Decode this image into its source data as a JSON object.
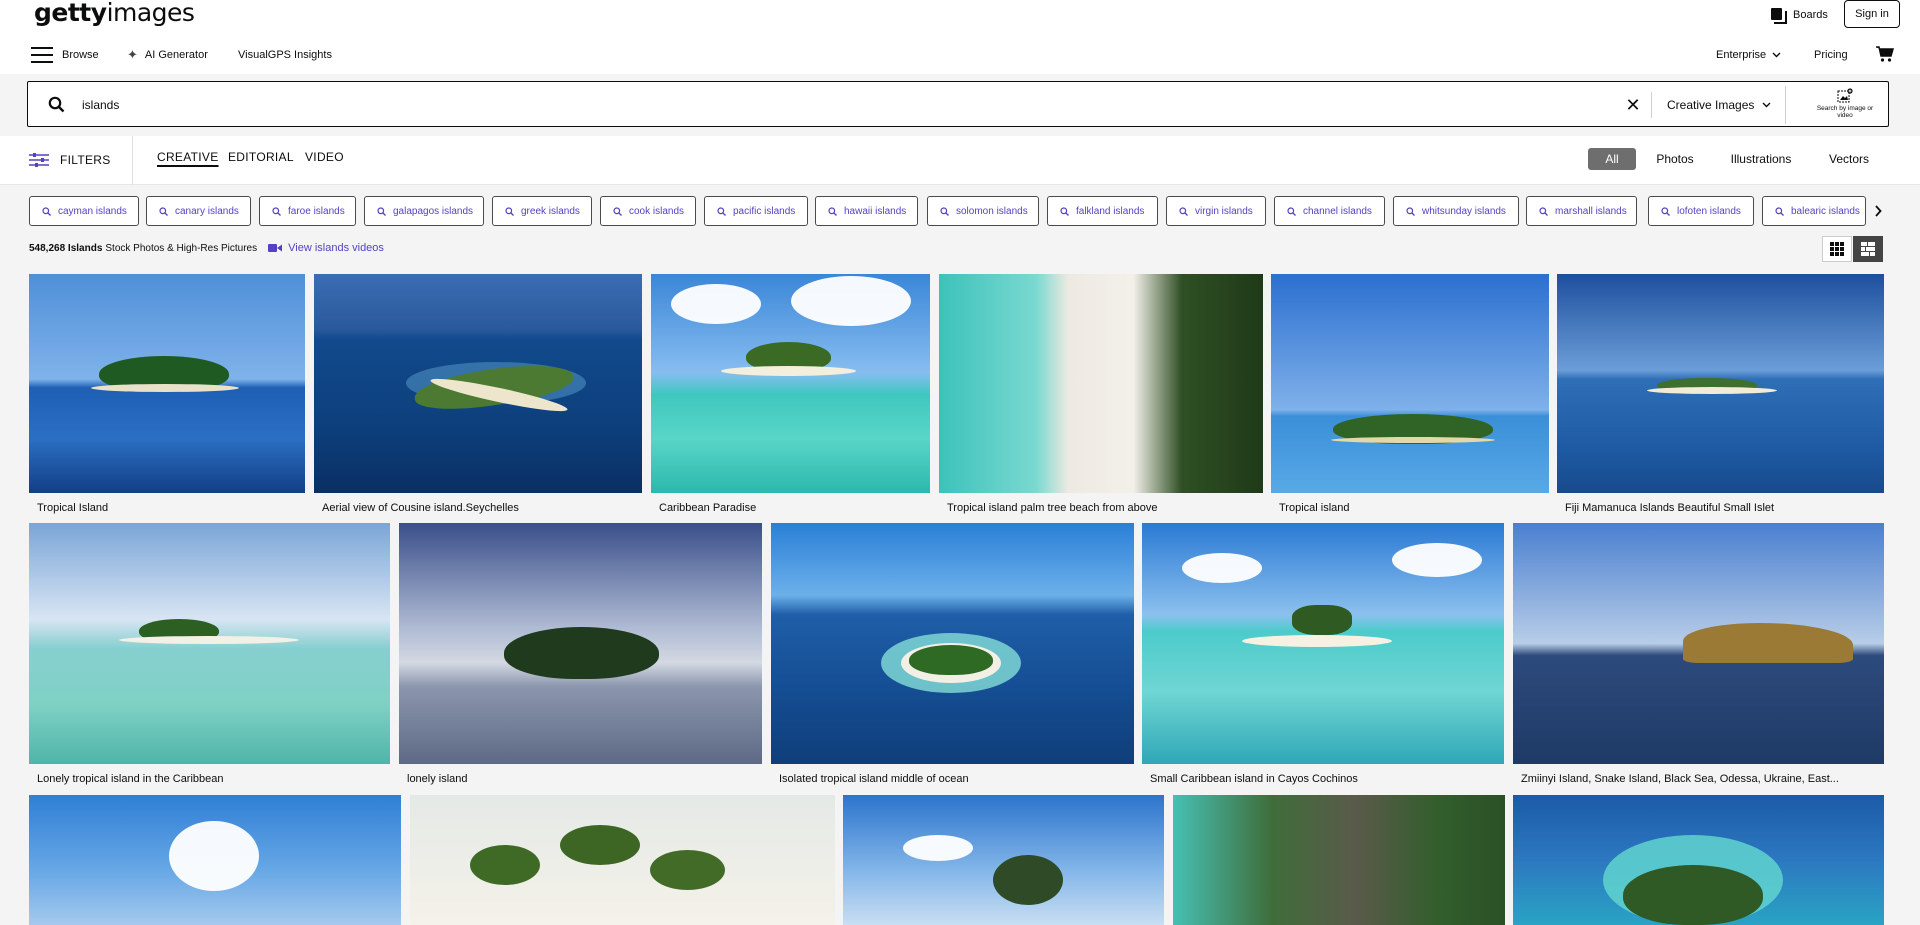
{
  "header": {
    "logo_bold": "getty",
    "logo_light": "images",
    "boards": "Boards",
    "sign_in": "Sign in"
  },
  "nav": {
    "browse": "Browse",
    "ai_generator": "AI Generator",
    "visualgps": "VisualGPS Insights",
    "enterprise": "Enterprise",
    "pricing": "Pricing"
  },
  "search": {
    "value": "islands",
    "scope": "Creative Images",
    "by_image": "Search by image or video"
  },
  "filters": {
    "label": "FILTERS",
    "tabs": [
      "CREATIVE",
      "EDITORIAL",
      "VIDEO"
    ],
    "active_tab": "CREATIVE",
    "types": [
      "All",
      "Photos",
      "Illustrations",
      "Vectors"
    ],
    "active_type": "All"
  },
  "chips": [
    "cayman islands",
    "canary islands",
    "faroe islands",
    "galapagos islands",
    "greek islands",
    "cook islands",
    "pacific islands",
    "hawaii islands",
    "solomon islands",
    "falkland islands",
    "virgin islands",
    "channel islands",
    "whitsunday islands",
    "marshall islands",
    "lofoten islands",
    "balearic islands"
  ],
  "results_info": {
    "count": "548,268 Islands",
    "suffix": "Stock Photos & High-Res Pictures",
    "video_link": "View islands videos"
  },
  "images": [
    {
      "caption": "Tropical Island"
    },
    {
      "caption": "Aerial view of Cousine island.Seychelles"
    },
    {
      "caption": "Caribbean Paradise"
    },
    {
      "caption": "Tropical island palm tree beach from above"
    },
    {
      "caption": "Tropical island"
    },
    {
      "caption": "Fiji Mamanuca Islands Beautiful Small Islet"
    },
    {
      "caption": "Lonely tropical island in the Caribbean"
    },
    {
      "caption": "lonely island"
    },
    {
      "caption": "Isolated tropical island middle of ocean"
    },
    {
      "caption": "Small Caribbean island in Cayos Cochinos"
    },
    {
      "caption": "Zmiinyi Island, Snake Island, Black Sea, Odessa, Ukraine, East..."
    },
    {
      "caption": ""
    },
    {
      "caption": ""
    },
    {
      "caption": ""
    },
    {
      "caption": ""
    },
    {
      "caption": ""
    }
  ],
  "colors": {
    "accent": "#5342c2",
    "band": "#f4f4f4",
    "active_pill": "#6e6e6e"
  }
}
